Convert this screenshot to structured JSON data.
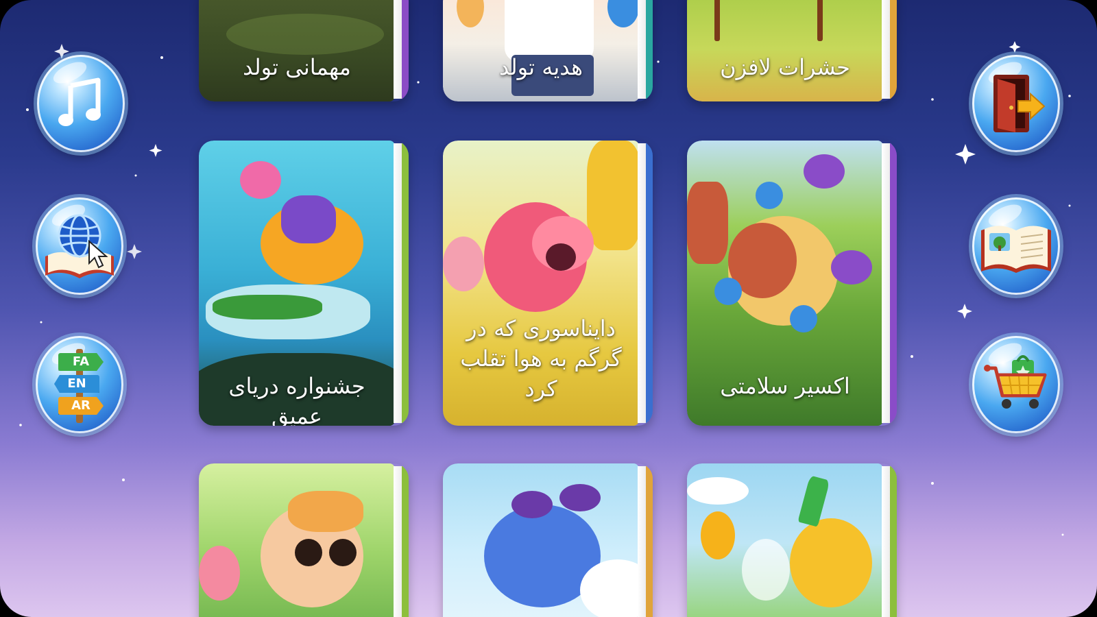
{
  "left_buttons": [
    {
      "name": "music",
      "icon": "music-note-icon"
    },
    {
      "name": "language-web",
      "icon": "globe-book-icon"
    },
    {
      "name": "language-switch",
      "icon": "language-sign-icon",
      "labels": [
        "FA",
        "EN",
        "AR"
      ]
    }
  ],
  "right_buttons": [
    {
      "name": "exit",
      "icon": "exit-door-icon"
    },
    {
      "name": "library",
      "icon": "open-book-icon"
    },
    {
      "name": "shop",
      "icon": "shopping-cart-icon"
    }
  ],
  "books": {
    "row1": [
      {
        "title": "حشرات لافزن",
        "spine": "#e0a43a"
      },
      {
        "title": "هدیه تولد",
        "spine": "#2aa7a0"
      },
      {
        "title": "مهمانی تولد",
        "spine": "#8b4cc6"
      }
    ],
    "row2": [
      {
        "title": "اکسیر سلامتی",
        "spine": "#8a4cc8"
      },
      {
        "title": "دایناسوری که در گرگم به هوا تقلب کرد",
        "spine": "#3a6fd0"
      },
      {
        "title": "جشنواره دریای عمیق",
        "spine": "#8cbf3c"
      }
    ],
    "row3": [
      {
        "title": "",
        "spine": "#8cbf3c"
      },
      {
        "title": "",
        "spine": "#e0a43a"
      },
      {
        "title": "",
        "spine": "#8cbf3c"
      }
    ]
  },
  "colors": {
    "accent": "#2a6fd2",
    "background_top": "#1d2a72",
    "background_bottom": "#ddc6ef"
  }
}
